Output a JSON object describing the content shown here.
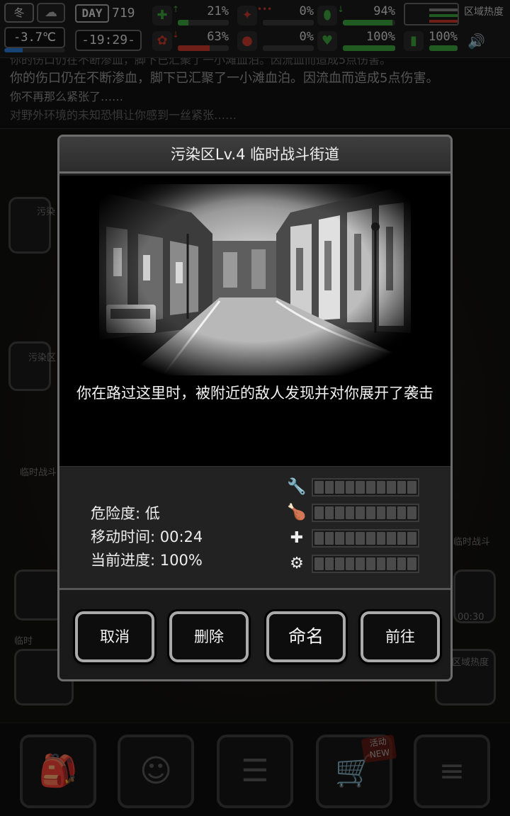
{
  "status": {
    "season": "冬",
    "temperature": "-3.7℃",
    "temperature_level": 0.3,
    "day_label": "DAY",
    "day_number": "719",
    "clock": "-19:29-",
    "stats": [
      {
        "id": "health",
        "icon": "medkit-icon",
        "arrow": "↑",
        "value": "21%",
        "level": 0.21,
        "color": "#3da63d"
      },
      {
        "id": "infection",
        "icon": "bird-icon",
        "arrow": "•••",
        "value": "0%",
        "level": 0.0,
        "color": "#c83a2a"
      },
      {
        "id": "hydration",
        "icon": "canteen-icon",
        "arrow": "↓",
        "value": "94%",
        "level": 0.94,
        "color": "#3da63d"
      },
      {
        "id": "mental",
        "icon": "brain-icon",
        "arrow": "↓",
        "value": "63%",
        "level": 0.63,
        "color": "#c83a2a"
      },
      {
        "id": "bleeding",
        "icon": "blood-drop-icon",
        "arrow": "",
        "value": "0%",
        "level": 0.0,
        "color": "#c83a2a"
      },
      {
        "id": "vitality",
        "icon": "heart-icon",
        "arrow": "",
        "value": "100%",
        "level": 1.0,
        "color": "#3da63d"
      },
      {
        "id": "battery",
        "icon": "signal-icon",
        "arrow": "",
        "value": "100%",
        "level": 1.0,
        "color": "#3da63d"
      }
    ],
    "region_heat": "区域热度"
  },
  "log": {
    "lines": [
      "你的伤口仍在不断渗血，脚下已汇聚了一小滩血泊。因流血而造成5点伤害。",
      "你的伤口仍在不断渗血，脚下已汇聚了一小滩血泊。因流血而造成5点伤害。",
      "你不再那么紧张了……",
      "对野外环境的未知恐惧让你感到一丝紧张……"
    ]
  },
  "background": {
    "labels": [
      "污染",
      "污染区",
      "临时战斗",
      "临时战斗",
      "区域热度",
      "临时"
    ],
    "timer": "00:30"
  },
  "dialog": {
    "title": "污染区Lv.4 临时战斗街道",
    "description": "你在路过这里时，被附近的敌人发现并对你展开了袭击",
    "danger": "危险度: 低",
    "move_time": "移动时间: 00:24",
    "progress": "当前进度: 100%",
    "resources": [
      {
        "icon": "weapon-icon",
        "glyph": "🔧",
        "filled": 0,
        "total": 10
      },
      {
        "icon": "food-icon",
        "glyph": "🍗",
        "filled": 0,
        "total": 10
      },
      {
        "icon": "medical-icon",
        "glyph": "✚",
        "filled": 0,
        "total": 10
      },
      {
        "icon": "parts-icon",
        "glyph": "⚙",
        "filled": 0,
        "total": 10
      }
    ],
    "buttons": {
      "cancel": "取消",
      "delete": "删除",
      "rename": "命名",
      "go": "前往"
    }
  },
  "bottom_nav": {
    "items": [
      {
        "id": "backpack",
        "icon": "backpack-icon",
        "glyph": "🎒"
      },
      {
        "id": "skills",
        "icon": "brain-head-icon",
        "glyph": "☺"
      },
      {
        "id": "tasks",
        "icon": "checklist-icon",
        "glyph": "☰"
      },
      {
        "id": "shop",
        "icon": "cart-icon",
        "glyph": "🛒"
      },
      {
        "id": "menu",
        "icon": "menu-icon",
        "glyph": "≡"
      }
    ],
    "shop_badge": "活动\nNEW"
  }
}
